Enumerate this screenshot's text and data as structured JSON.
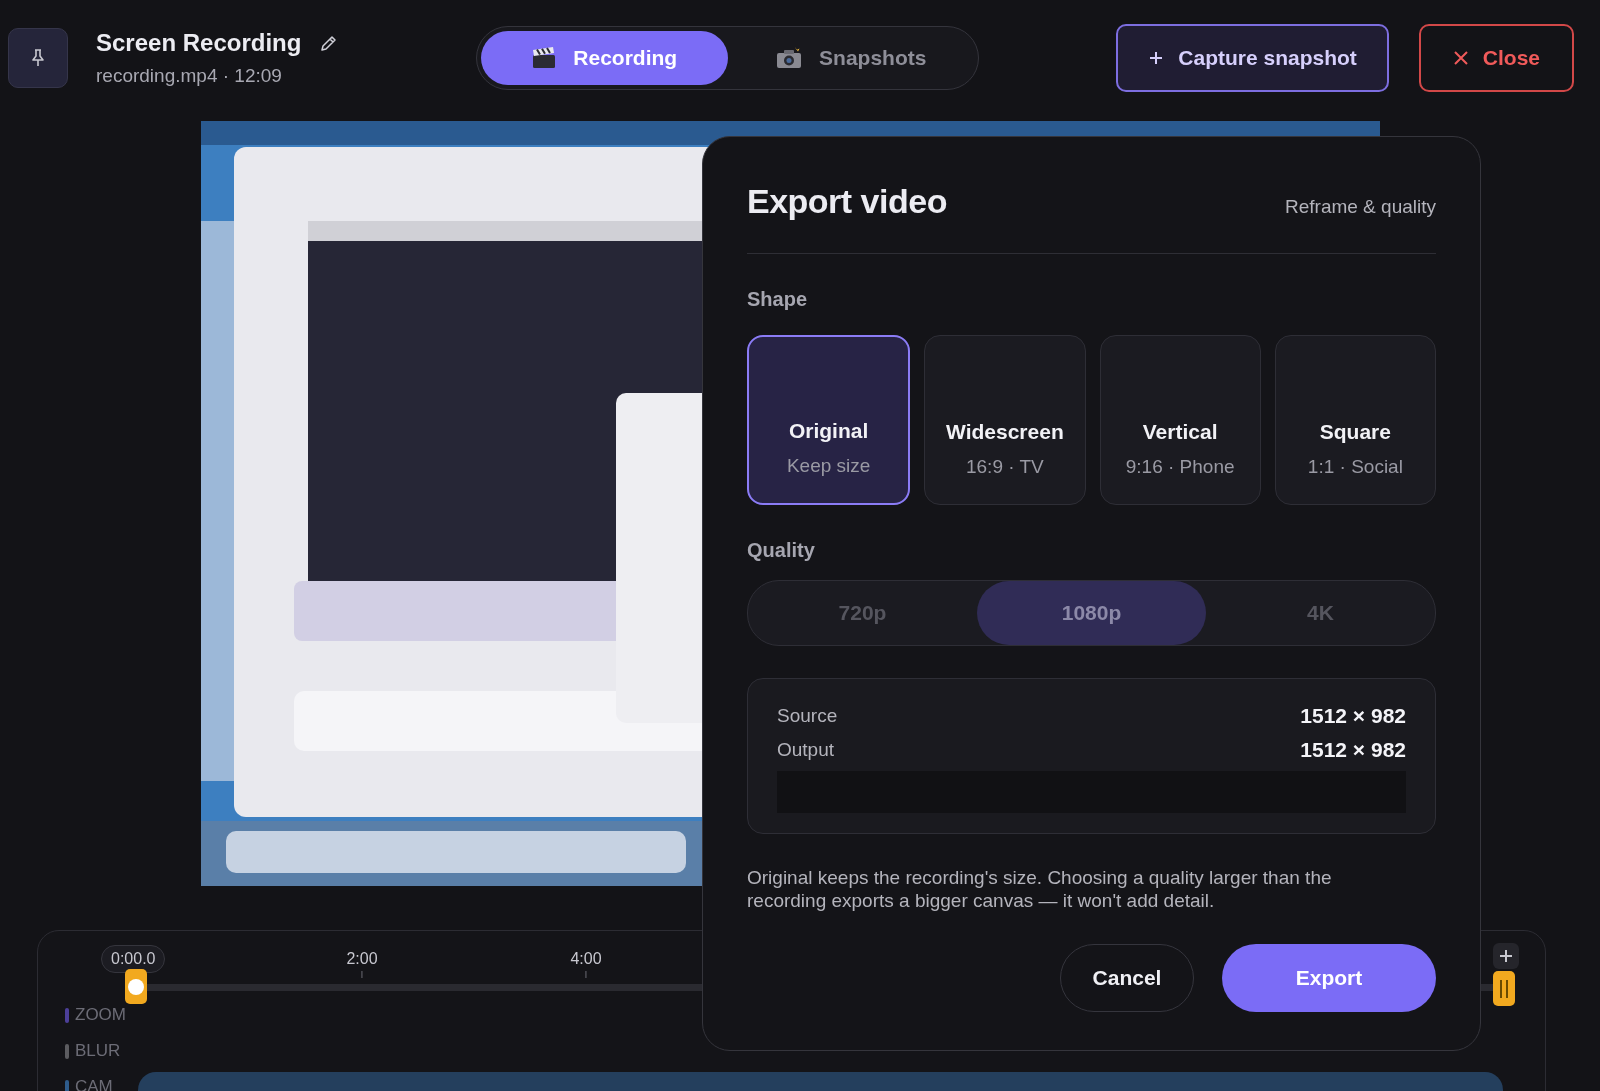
{
  "header": {
    "title": "Screen Recording",
    "subtitle": "recording.mp4 · 12:09"
  },
  "tabs": [
    {
      "label": "Recording",
      "kind": "clapper",
      "selected": true
    },
    {
      "label": "Snapshots",
      "kind": "camera",
      "selected": false
    }
  ],
  "actions": [
    {
      "kind": "capture",
      "label": "Capture snapshot"
    },
    {
      "kind": "close",
      "label": "Close"
    }
  ],
  "export_dialog": {
    "title": "Export video",
    "subtitle": "Reframe & quality",
    "shape_label": "Shape",
    "shapes": [
      {
        "name": "Original",
        "detail": "Keep size",
        "selected": true
      },
      {
        "name": "Widescreen",
        "detail": "16:9 · TV",
        "selected": false
      },
      {
        "name": "Vertical",
        "detail": "9:16 · Phone",
        "selected": false
      },
      {
        "name": "Square",
        "detail": "1:1 · Social",
        "selected": false
      }
    ],
    "quality_label": "Quality",
    "qualities": [
      {
        "label": "720p",
        "selected": false
      },
      {
        "label": "1080p",
        "selected": true
      },
      {
        "label": "4K",
        "selected": false
      }
    ],
    "info": [
      {
        "label": "Source",
        "value": "1512 × 982"
      },
      {
        "label": "Output",
        "value": "1512 × 982"
      }
    ],
    "note": "Original keeps the recording's size. Choosing a quality larger than the recording exports a bigger canvas — it won't add detail.",
    "buttons": [
      {
        "kind": "secondary",
        "label": "Cancel"
      },
      {
        "kind": "primary",
        "label": "Export"
      }
    ]
  },
  "timeline": {
    "playhead": "0:00.0",
    "ticks": [
      "2:00",
      "4:00"
    ],
    "tracks": [
      {
        "label": "ZOOM",
        "color": "#4c3f99"
      },
      {
        "label": "BLUR",
        "color": "#5c5c60"
      },
      {
        "label": "CAM",
        "color": "#2e5c8c"
      }
    ]
  }
}
